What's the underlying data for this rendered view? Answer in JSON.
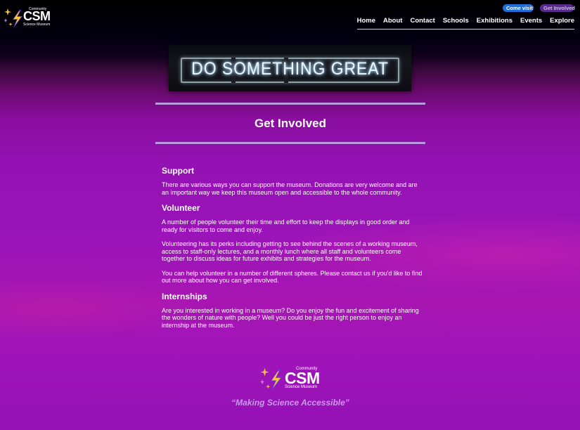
{
  "brand": {
    "community": "Community",
    "name": "CSM",
    "subtitle": "Science Museum"
  },
  "header": {
    "come_visit": "Come visit",
    "get_involved": "Get Involved"
  },
  "nav": {
    "items": [
      "Home",
      "About",
      "Contact",
      "Schools",
      "Exhibitions",
      "Events",
      "Explore"
    ]
  },
  "hero": {
    "sign_text": "DO SOMETHING GREAT"
  },
  "page": {
    "title": "Get Involved"
  },
  "sections": {
    "support": {
      "heading": "Support",
      "p1": "There are various ways you can support the museum. Donations are very welcome and are an important way we keep this museum open and accessible to the whole community."
    },
    "volunteer": {
      "heading": "Volunteer",
      "p1": "A number of people volunteer their time and effort to keep the displays in good order and ready for visitors to come and enjoy.",
      "p2": "Volunteering has its perks including getting to see behind the scenes of a working museum, access to staff-only lectures, and a monthly lunch where all staff and volunteers come together to discuss ideas for future exhibits and strategies for the museum.",
      "p3": "You can help volunteer in a number of different spheres. Please contact us if you'd like to find out more about how you can get involved."
    },
    "internships": {
      "heading": "Internships",
      "p1": "Are you interested in working in a museum? Do you enjoy the fun and excitement of sharing the wonders of nature with people? Well you could be just the right person to enjoy an internship at the museum."
    }
  },
  "footer": {
    "tagline": "“Making Science Accessible”"
  },
  "colors": {
    "accent_blue": "#1e6fd8",
    "accent_purple": "#5a2a8a",
    "rule": "#b89ae0",
    "tagline": "#c89ae8"
  }
}
